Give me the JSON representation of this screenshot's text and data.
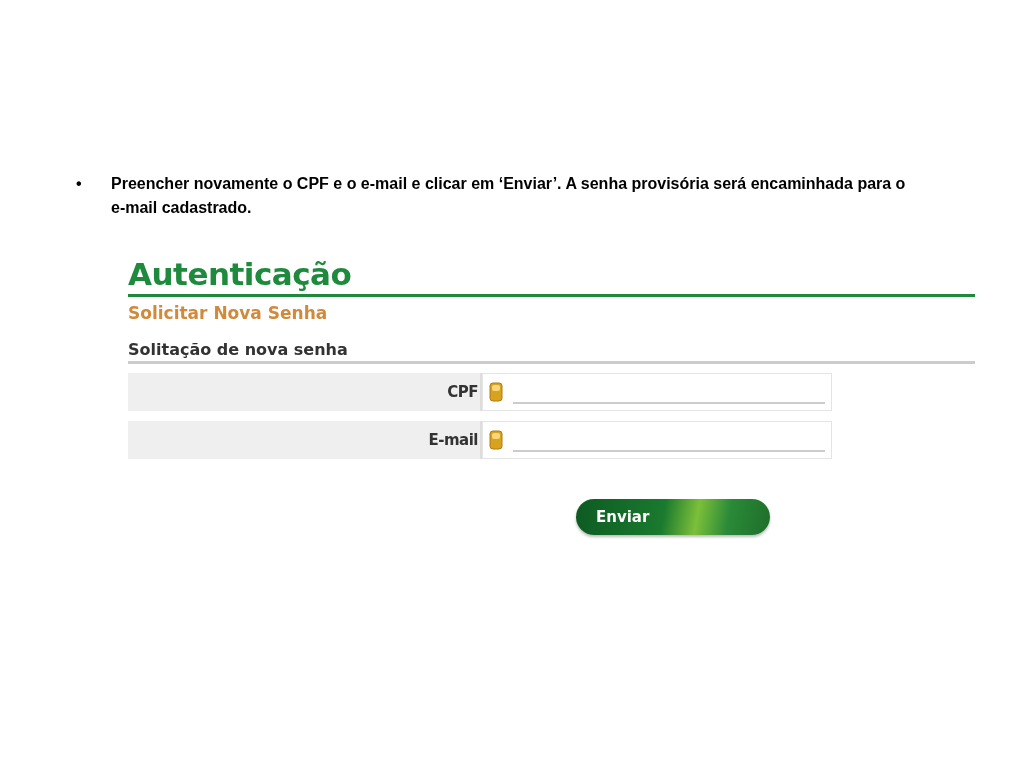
{
  "bullet": {
    "marker": "•",
    "text": "Preencher novamente o CPF e o e-mail e clicar em ‘Enviar’. A senha provisória será encaminhada para o e-mail cadastrado."
  },
  "form": {
    "title": "Autenticação",
    "subtitle": "Solicitar Nova Senha",
    "section": "Solitação de nova senha",
    "fields": [
      {
        "label": "CPF"
      },
      {
        "label": "E-mail"
      }
    ],
    "button": "Enviar"
  }
}
